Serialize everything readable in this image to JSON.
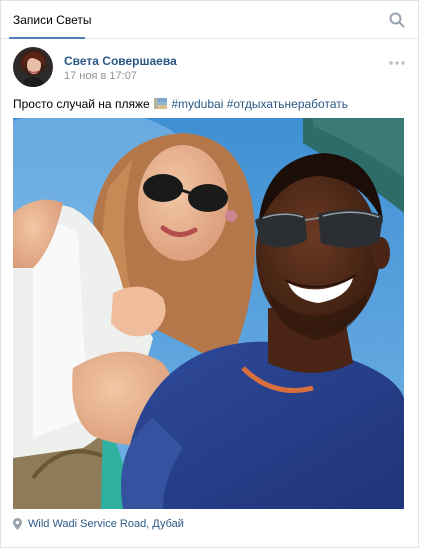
{
  "header": {
    "tab_label": "Записи Светы",
    "search_icon": "search-icon"
  },
  "post": {
    "author": "Света Совершаева",
    "date": "17 ноя в 17:07",
    "text_prefix": "Просто случай на пляже",
    "flag_icon": "uae-flag-icon",
    "hashtags": [
      "#mydubai",
      "#отдыхатьнеработать"
    ],
    "location": "Wild Wadi Service Road, Дубай",
    "location_icon": "map-pin-icon"
  },
  "colors": {
    "link": "#2a5885",
    "muted": "#939393",
    "accent": "#5181b8",
    "border": "#e7e8ec"
  }
}
